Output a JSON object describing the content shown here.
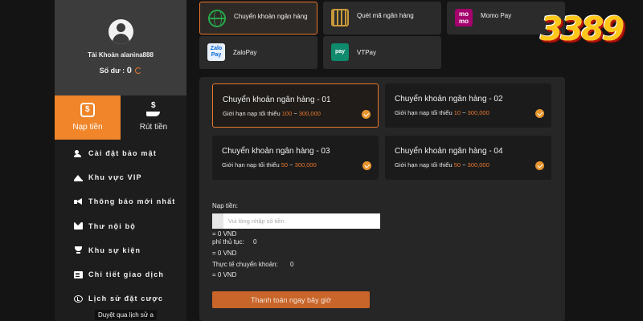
{
  "brand": {
    "logo_text": "3389"
  },
  "sidebar": {
    "account_label": "Tài Khoản alanina888",
    "balance_label": "Số dư :",
    "balance_value": "0",
    "tabs": [
      {
        "label": "Nạp tiền",
        "active": true
      },
      {
        "label": "Rút tiền",
        "active": false
      }
    ],
    "menu": [
      {
        "label": "Cài đặt bảo mật",
        "icon": "user-cog-icon"
      },
      {
        "label": "Khu vực VIP",
        "icon": "crown-icon"
      },
      {
        "label": "Thông báo mới nhất",
        "icon": "megaphone-icon"
      },
      {
        "label": "Thư nội bộ",
        "icon": "envelope-icon"
      },
      {
        "label": "Khu sự kiện",
        "icon": "trophy-icon"
      },
      {
        "label": "Chi tiết giao dịch",
        "icon": "list-icon"
      },
      {
        "label": "Lịch sử đặt cược",
        "icon": "history-icon"
      }
    ],
    "tooltip": "Duyệt qua lịch sử a"
  },
  "methods": [
    {
      "label": "Chuyển khoản ngân hàng",
      "logo": "globe-icon",
      "selected": true
    },
    {
      "label": "Quét mã ngân hàng",
      "logo": "qr-icon",
      "selected": false
    },
    {
      "label": "Momo Pay",
      "logo_text": "mo mo",
      "selected": false
    },
    {
      "label": "ZaloPay",
      "logo_text": "Zalo Pay",
      "selected": false
    },
    {
      "label": "VTPay",
      "logo_text": "pay",
      "selected": false
    }
  ],
  "banks": [
    {
      "name": "Chuyển khoản ngân hàng - 01",
      "limit_prefix": "Giới hạn nạp tối thiểu",
      "min": "100",
      "sep": "~",
      "max": "300,000",
      "selected": true
    },
    {
      "name": "Chuyển khoản ngân hàng - 02",
      "limit_prefix": "Giới hạn nạp tối thiểu",
      "min": "10",
      "sep": "~",
      "max": "300,000",
      "selected": false
    },
    {
      "name": "Chuyển khoản ngân hàng - 03",
      "limit_prefix": "Giới hạn nạp tối thiểu",
      "min": "50",
      "sep": "~",
      "max": "300,000",
      "selected": false
    },
    {
      "name": "Chuyển khoản ngân hàng - 04",
      "limit_prefix": "Giới hạn nạp tối thiểu",
      "min": "50",
      "sep": "~",
      "max": "300,000",
      "selected": false
    }
  ],
  "form": {
    "amount_label": "Nạp tiền:",
    "amount_placeholder": "Vui lòng nhập số tiền",
    "amount_result": "= 0 VND",
    "fee_label": "phí thủ tục:",
    "fee_value": "0",
    "fee_result": "= 0 VND",
    "actual_label": "Thực tế chuyển khoản:",
    "actual_value": "0",
    "actual_result": "= 0 VND",
    "submit_label": "Thanh toán ngay bây giờ"
  },
  "colors": {
    "accent": "#f0852a",
    "highlight": "#e8772e",
    "background": "#141414"
  }
}
